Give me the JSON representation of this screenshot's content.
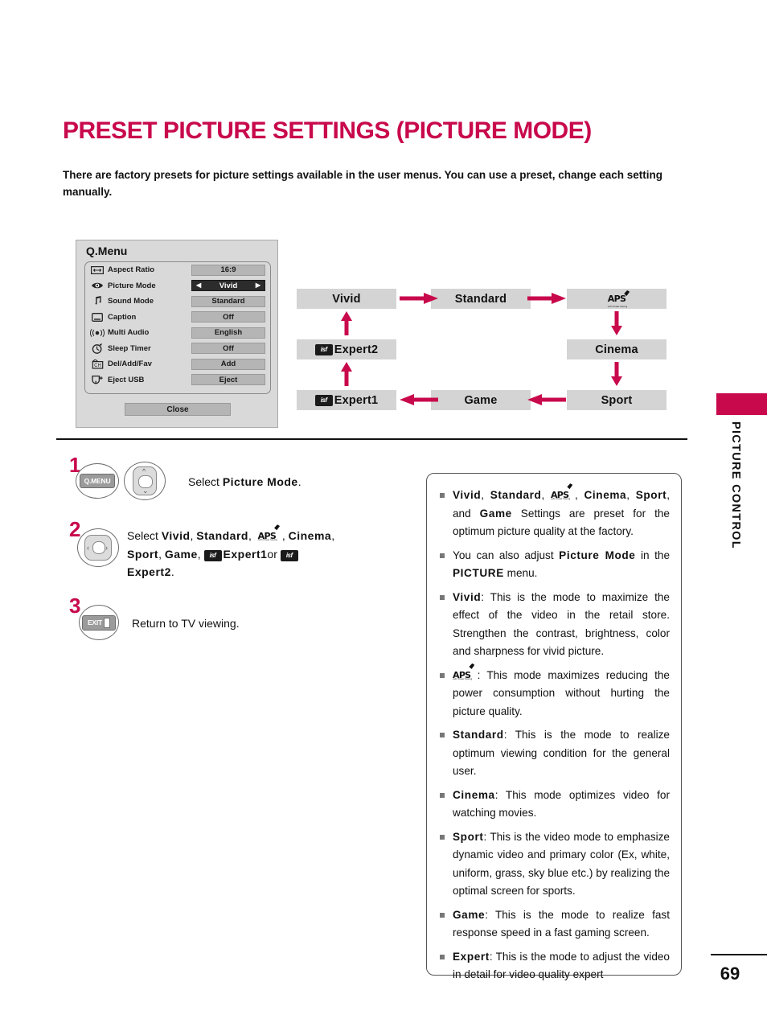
{
  "page": {
    "title": "PRESET PICTURE SETTINGS (PICTURE MODE)",
    "intro": "There are factory presets for picture settings available in the user menus. You can use a preset, change each setting manually.",
    "side_tab": "PICTURE CONTROL",
    "number": "69",
    "accent_color": "#c8094c"
  },
  "qmenu": {
    "title": "Q.Menu",
    "rows": [
      {
        "icon": "aspect-ratio-icon",
        "label": "Aspect Ratio",
        "value": "16:9",
        "selected": false
      },
      {
        "icon": "eye-icon",
        "label": "Picture Mode",
        "value": "Vivid",
        "selected": true,
        "left_arrow": "◀",
        "right_arrow": "▶"
      },
      {
        "icon": "music-note-icon",
        "label": "Sound Mode",
        "value": "Standard",
        "selected": false
      },
      {
        "icon": "caption-icon",
        "label": "Caption",
        "value": "Off",
        "selected": false
      },
      {
        "icon": "multi-audio-icon",
        "label": "Multi Audio",
        "value": "English",
        "selected": false
      },
      {
        "icon": "sleep-timer-icon",
        "label": "Sleep Timer",
        "value": "Off",
        "selected": false
      },
      {
        "icon": "channel-icon",
        "label": "Del/Add/Fav",
        "value": "Add",
        "selected": false
      },
      {
        "icon": "usb-eject-icon",
        "label": "Eject USB",
        "value": "Eject",
        "selected": false
      }
    ],
    "close_label": "Close"
  },
  "flow": {
    "boxes": [
      {
        "id": "vivid",
        "label": "Vivid",
        "icon": null
      },
      {
        "id": "standard",
        "label": "Standard",
        "icon": null
      },
      {
        "id": "aps",
        "label": "",
        "icon": "aps-icon"
      },
      {
        "id": "cinema",
        "label": "Cinema",
        "icon": null
      },
      {
        "id": "sport",
        "label": "Sport",
        "icon": null
      },
      {
        "id": "game",
        "label": "Game",
        "icon": null
      },
      {
        "id": "expert1",
        "label": "Expert1",
        "icon": "isf-icon"
      },
      {
        "id": "expert2",
        "label": "Expert2",
        "icon": "isf-icon"
      }
    ],
    "aps_caption": "Auto Power Saving"
  },
  "steps": [
    {
      "number": "1",
      "keys": [
        "Q.MENU",
        "up-down-dpad"
      ],
      "key_label": "Q.MENU",
      "text_plain_1": "Select ",
      "text_bold_1": "Picture Mode",
      "text_plain_2": "."
    },
    {
      "number": "2",
      "keys": [
        "left-right-dpad"
      ],
      "text_prefix": "Select ",
      "items": [
        "Vivid",
        "Standard",
        "APS",
        "Cinema",
        "Sport",
        "Game",
        "Expert1",
        "Expert2"
      ],
      "conjunction": "or"
    },
    {
      "number": "3",
      "keys": [
        "EXIT"
      ],
      "key_label": "EXIT",
      "text": "Return to TV viewing."
    }
  ],
  "description": {
    "items": [
      {
        "id": "presets",
        "html_parts": [
          {
            "t": "b",
            "v": "Vivid"
          },
          {
            "t": "n",
            "v": ", "
          },
          {
            "t": "b",
            "v": "Standard"
          },
          {
            "t": "n",
            "v": ",  "
          },
          {
            "t": "aps",
            "v": ""
          },
          {
            "t": "n",
            "v": " , "
          },
          {
            "t": "b",
            "v": "Cinema"
          },
          {
            "t": "n",
            "v": ", "
          },
          {
            "t": "b",
            "v": "Sport"
          },
          {
            "t": "n",
            "v": ",  and "
          },
          {
            "t": "b",
            "v": "Game"
          },
          {
            "t": "n",
            "v": " Settings are preset for the optimum picture quality at the factory."
          }
        ]
      },
      {
        "id": "picture-mode-menu",
        "html_parts": [
          {
            "t": "n",
            "v": "You can also adjust "
          },
          {
            "t": "b",
            "v": "Picture Mode"
          },
          {
            "t": "n",
            "v": " in the "
          },
          {
            "t": "b",
            "v": "PICTURE"
          },
          {
            "t": "n",
            "v": " menu."
          }
        ]
      },
      {
        "id": "vivid",
        "html_parts": [
          {
            "t": "b",
            "v": "Vivid"
          },
          {
            "t": "n",
            "v": ": This is the mode to maximize the effect of the video in the retail store. Strengthen the contrast, brightness, color and sharpness for vivid picture."
          }
        ]
      },
      {
        "id": "aps",
        "html_parts": [
          {
            "t": "aps",
            "v": ""
          },
          {
            "t": "n",
            "v": " : This mode maximizes reducing the power consumption without hurting the picture quality."
          }
        ]
      },
      {
        "id": "standard",
        "html_parts": [
          {
            "t": "b",
            "v": "Standard"
          },
          {
            "t": "n",
            "v": ": This is the mode to realize optimum viewing condition for the general user."
          }
        ]
      },
      {
        "id": "cinema",
        "html_parts": [
          {
            "t": "b",
            "v": "Cinema"
          },
          {
            "t": "n",
            "v": ": This mode optimizes video for watching movies."
          }
        ]
      },
      {
        "id": "sport",
        "html_parts": [
          {
            "t": "b",
            "v": "Sport"
          },
          {
            "t": "n",
            "v": ": This is the video mode to emphasize dynamic video and primary color (Ex, white, uniform, grass, sky blue etc.) by realizing the optimal screen for sports."
          }
        ]
      },
      {
        "id": "game",
        "html_parts": [
          {
            "t": "b",
            "v": "Game"
          },
          {
            "t": "n",
            "v": ": This is the mode to realize fast response speed in a fast gaming screen."
          }
        ]
      },
      {
        "id": "expert",
        "html_parts": [
          {
            "t": "b",
            "v": "Expert"
          },
          {
            "t": "n",
            "v": ": This is the mode to adjust the video in detail for video quality expert"
          }
        ]
      }
    ]
  }
}
